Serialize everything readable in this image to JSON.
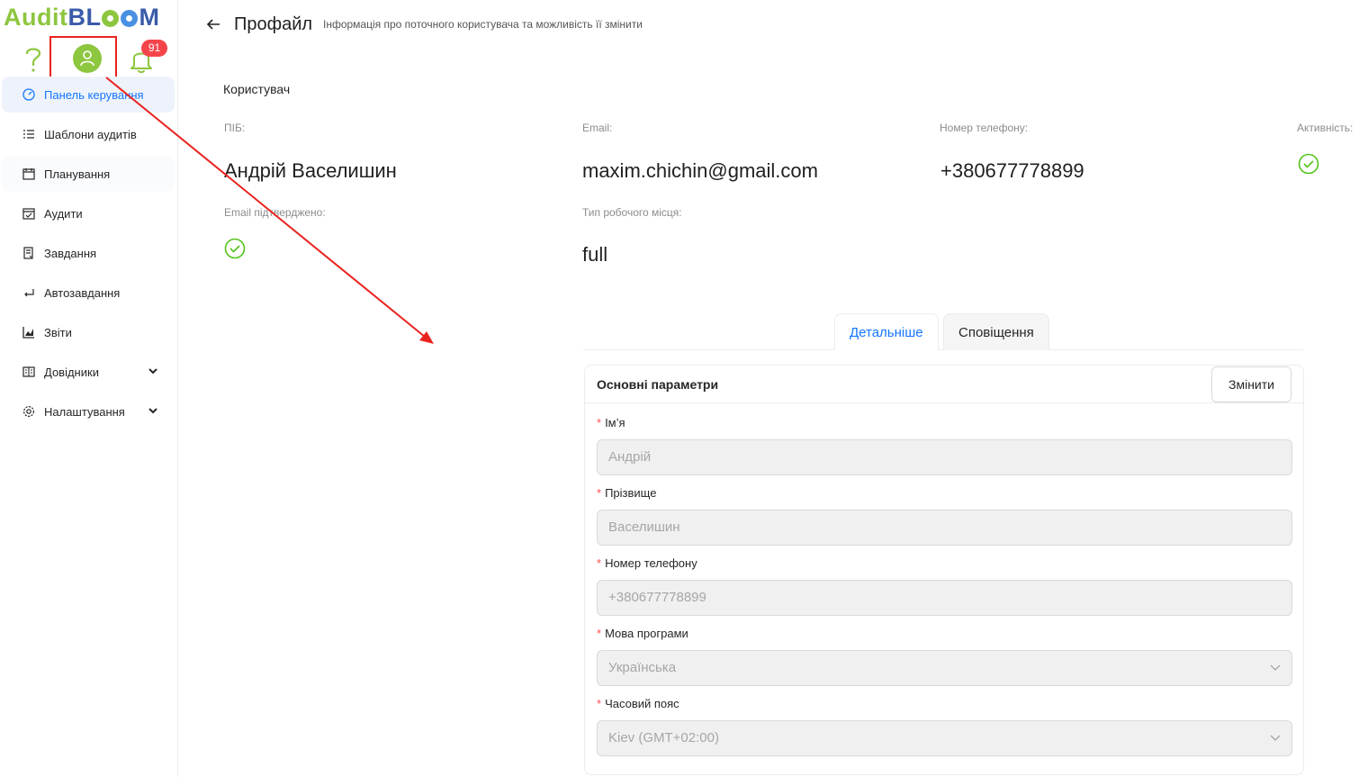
{
  "app": {
    "logo_part1": "Audit",
    "logo_part2": "BL",
    "logo_part3": "M"
  },
  "topbar": {
    "notification_count": "91"
  },
  "sidebar": {
    "items": [
      {
        "label": "Панель керування",
        "icon": "dashboard-icon"
      },
      {
        "label": "Шаблони аудитів",
        "icon": "list-icon"
      },
      {
        "label": "Планування",
        "icon": "calendar-icon"
      },
      {
        "label": "Аудити",
        "icon": "calendar-check-icon"
      },
      {
        "label": "Завдання",
        "icon": "task-icon"
      },
      {
        "label": "Автозавдання",
        "icon": "enter-icon"
      },
      {
        "label": "Звіти",
        "icon": "chart-icon"
      },
      {
        "label": "Довідники",
        "icon": "book-icon"
      },
      {
        "label": "Налаштування",
        "icon": "gear-icon"
      }
    ]
  },
  "header": {
    "title": "Профайл",
    "subtitle": "Інформація про поточного користувача та можливість її змінити"
  },
  "user": {
    "section_title": "Користувач",
    "fio_label": "ПІБ:",
    "fio_value": "Андрій Васелишин",
    "email_label": "Email:",
    "email_value": "maxim.chichin@gmail.com",
    "phone_label": "Номер телефону:",
    "phone_value": "+380677778899",
    "active_label": "Активність:",
    "email_confirmed_label": "Email підтверджено:",
    "workplace_label": "Тип робочого місця:",
    "workplace_value": "full"
  },
  "tabs": [
    {
      "label": "Детальніше",
      "active": true
    },
    {
      "label": "Сповіщення",
      "active": false
    }
  ],
  "card": {
    "title": "Основні параметри",
    "edit_label": "Змінити",
    "fields": [
      {
        "label": "Ім’я",
        "value": "Андрій"
      },
      {
        "label": "Прізвище",
        "value": "Васелишин"
      },
      {
        "label": "Номер телефону",
        "value": "+380677778899"
      },
      {
        "label": "Мова програми",
        "value": "Українська"
      },
      {
        "label": "Часовий пояс",
        "value": "Kiev (GMT+02:00)"
      }
    ]
  },
  "colors": {
    "brand_green": "#8dc63f",
    "brand_blue": "#3a5ba9",
    "accent": "#1677ff",
    "badge": "#f5454b",
    "annotation": "#e8231f"
  }
}
